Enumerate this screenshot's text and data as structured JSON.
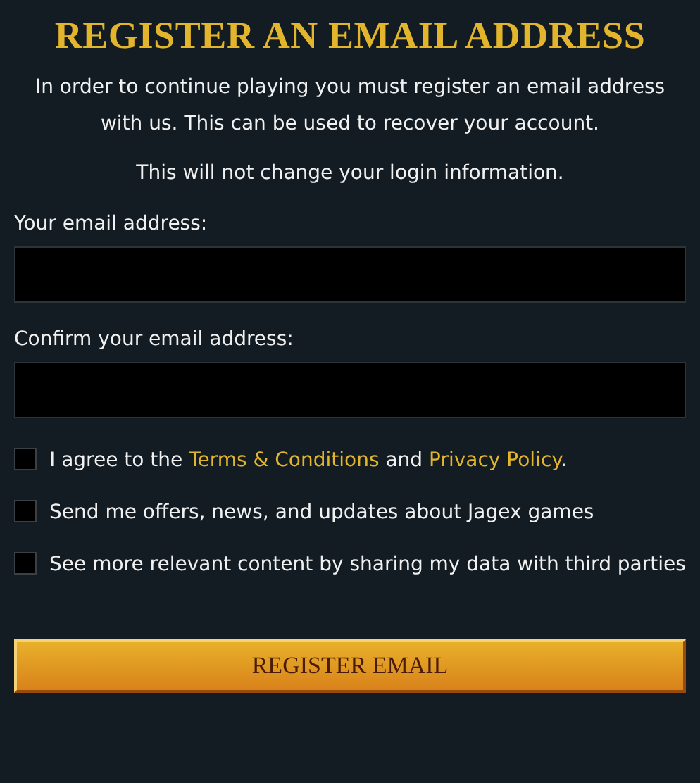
{
  "title": "REGISTER AN EMAIL ADDRESS",
  "intro": "In order to continue playing you must register an email address with us. This can be used to recover your account.",
  "note": "This will not change your login information.",
  "fields": [
    {
      "label": "Your email address:"
    },
    {
      "label": "Confirm your email address:"
    }
  ],
  "checkboxes": [
    {
      "checked": false,
      "parts": [
        {
          "kind": "text",
          "text": "I agree to the "
        },
        {
          "kind": "link",
          "text": "Terms & Conditions"
        },
        {
          "kind": "text",
          "text": " and "
        },
        {
          "kind": "link",
          "text": "Privacy Policy"
        },
        {
          "kind": "text",
          "text": "."
        }
      ]
    },
    {
      "checked": false,
      "parts": [
        {
          "kind": "text",
          "text": "Send me offers, news, and updates about Jagex games"
        }
      ]
    },
    {
      "checked": false,
      "parts": [
        {
          "kind": "text",
          "text": "See more relevant content by sharing my data with third parties"
        }
      ]
    }
  ],
  "button": "REGISTER EMAIL"
}
